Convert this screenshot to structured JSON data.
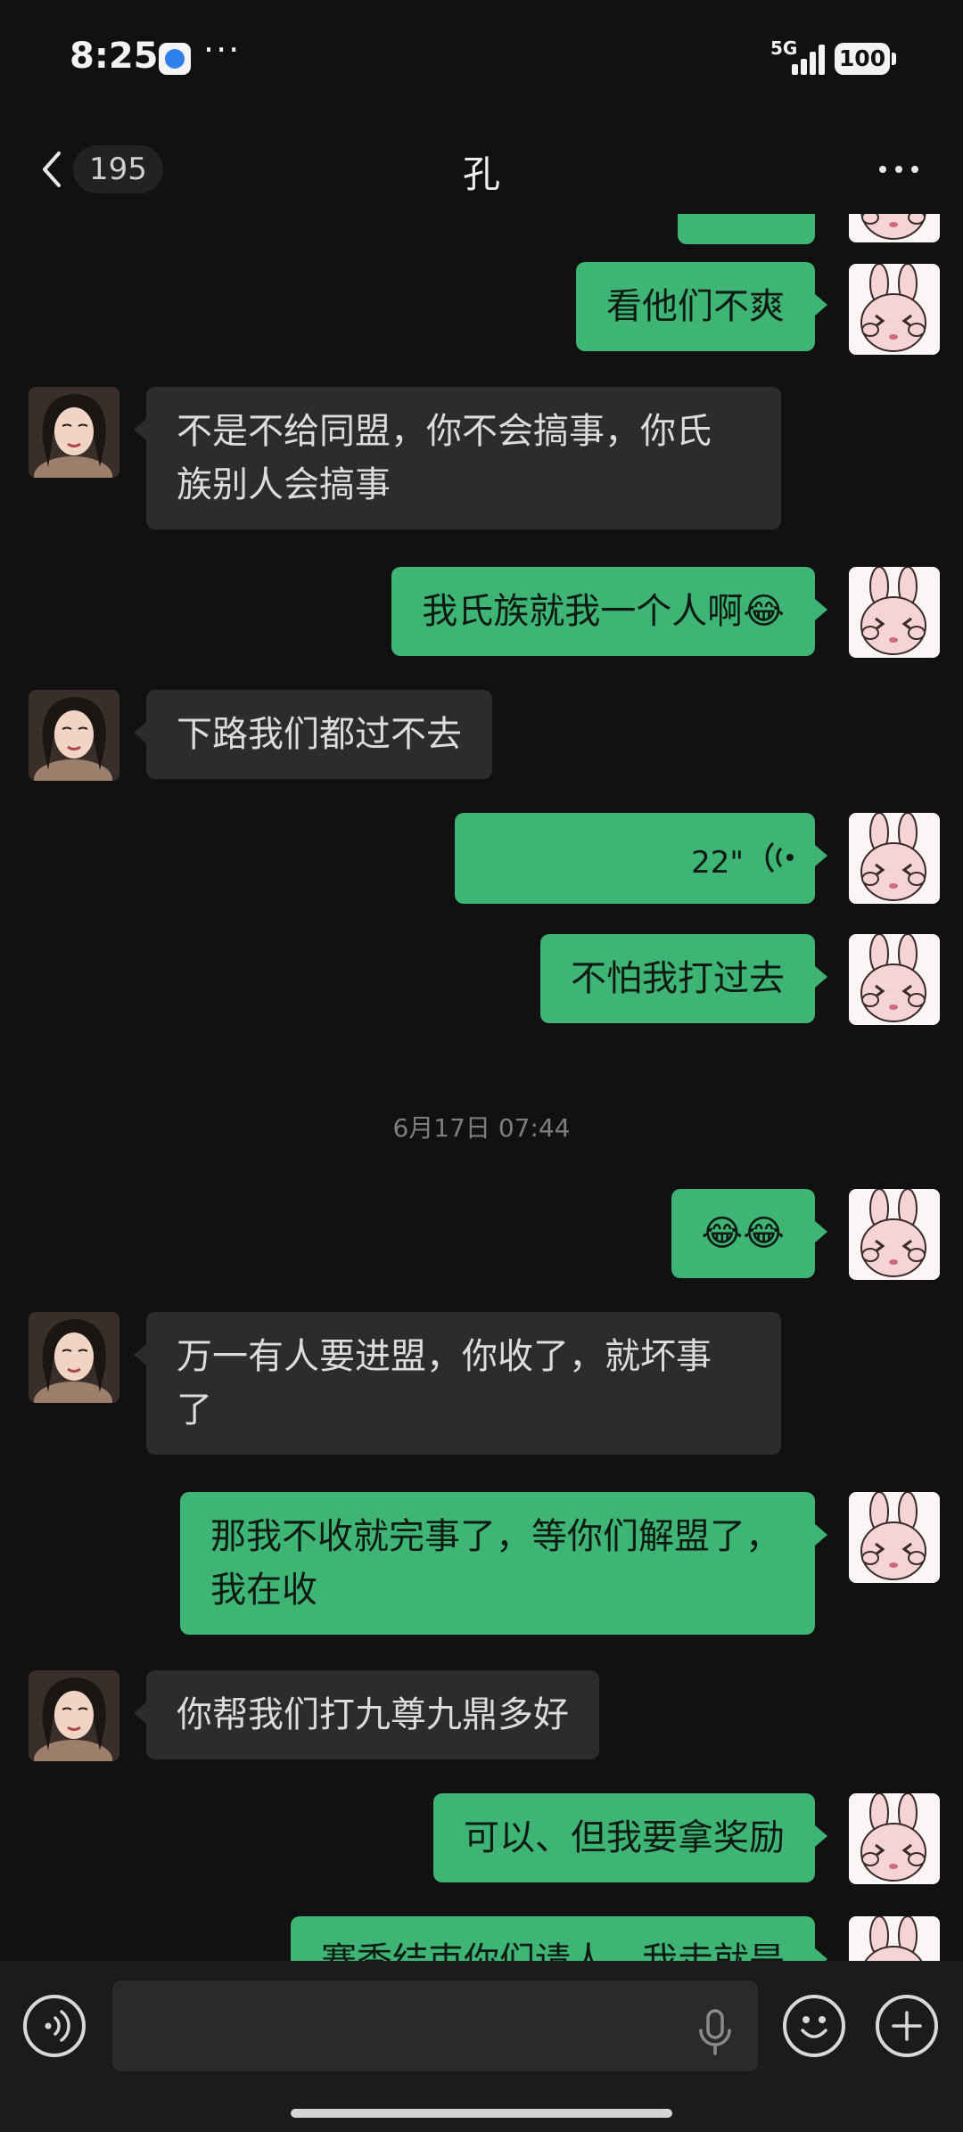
{
  "status_bar": {
    "time": "8:25",
    "network": "5G",
    "battery": "100",
    "overflow_dots": "···"
  },
  "nav": {
    "unread_count": "195",
    "title": "孔"
  },
  "messages": [
    {
      "side": "mine",
      "text": "看他们不爽"
    },
    {
      "side": "theirs",
      "line1": "不是不给同盟，你不会搞事，你氏",
      "line2": "族别人会搞事"
    },
    {
      "side": "mine",
      "text": "我氏族就我一个人啊",
      "emoji": "😂"
    },
    {
      "side": "theirs",
      "text": "下路我们都过不去"
    },
    {
      "side": "mine",
      "type": "voice",
      "duration": "22\""
    },
    {
      "side": "mine",
      "text": "不怕我打过去"
    },
    {
      "side": "mine",
      "emoji": "😂😂"
    },
    {
      "side": "theirs",
      "line1": "万一有人要进盟，你收了，就坏事",
      "line2": "了"
    },
    {
      "side": "mine",
      "line1": "那我不收就完事了，等你们解盟了，",
      "line2": "我在收"
    },
    {
      "side": "theirs",
      "text": "你帮我们打九尊九鼎多好"
    },
    {
      "side": "mine",
      "text": "可以、但我要拿奖励"
    },
    {
      "side": "mine",
      "text": "赛季结束你们请人，我走就是"
    }
  ],
  "timestamp": "6月17日 07:44",
  "colors": {
    "mine_bubble": "#3eb575",
    "theirs_bubble": "#2c2c2c",
    "background": "#111111"
  },
  "icons": [
    "back-arrow",
    "more-dots",
    "voice-wave",
    "microphone",
    "smiley",
    "plus"
  ]
}
